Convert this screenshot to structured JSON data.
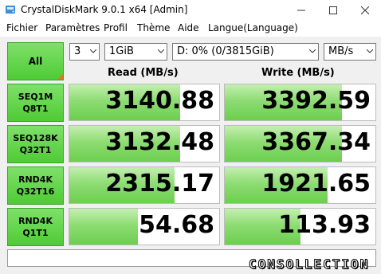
{
  "window": {
    "title": "CrystalDiskMark 9.0.1 x64 [Admin]",
    "icon": "app-disk-icon",
    "controls": [
      "minimize-icon",
      "maximize-icon",
      "close-icon"
    ]
  },
  "menu": [
    "Fichier",
    "Paramètres",
    "Profil",
    "Thème",
    "Aide",
    "Langue(Language)"
  ],
  "toolbar": {
    "all_label": "All",
    "count": "3",
    "size": "1GiB",
    "drive": "D: 0% (0/3815GiB)",
    "unit": "MB/s"
  },
  "headers": {
    "read": "Read (MB/s)",
    "write": "Write (MB/s)"
  },
  "rows": [
    {
      "line1": "SEQ1M",
      "line2": "Q8T1",
      "read": "3140.88",
      "write": "3392.59",
      "read_fill": 0.74,
      "write_fill": 0.78
    },
    {
      "line1": "SEQ128K",
      "line2": "Q32T1",
      "read": "3132.48",
      "write": "3367.34",
      "read_fill": 0.74,
      "write_fill": 0.78
    },
    {
      "line1": "RND4K",
      "line2": "Q32T16",
      "read": "2315.17",
      "write": "1921.65",
      "read_fill": 0.7,
      "write_fill": 0.68
    },
    {
      "line1": "RND4K",
      "line2": "Q1T1",
      "read": "54.68",
      "write": "113.93",
      "read_fill": 0.46,
      "write_fill": 0.5
    }
  ],
  "comment": "",
  "watermark": "CONSOLLECTION",
  "colors": {
    "accent_green": "#4fcb35",
    "bar_green": "#8edc74",
    "corner_orange": "#e8731c"
  }
}
